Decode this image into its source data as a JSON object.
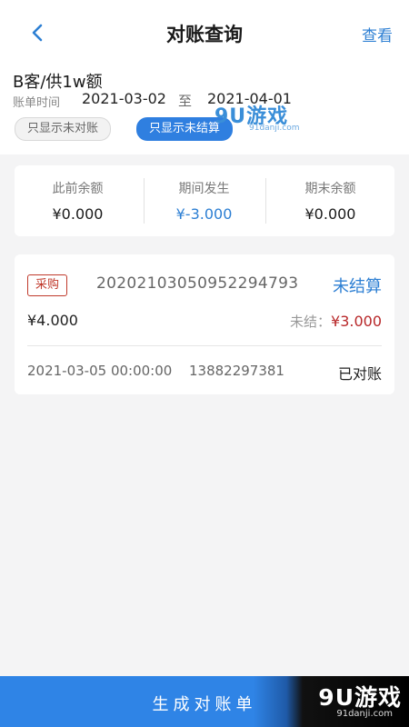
{
  "header": {
    "title": "对账查询",
    "view_label": "查看"
  },
  "info": {
    "customer": "B客/供1w额",
    "period_label": "账单时间",
    "start_date": "2021-03-02",
    "separator": "至",
    "end_date": "2021-04-01",
    "chips": [
      {
        "label": "只显示未对账",
        "active": false
      },
      {
        "label": "只显示未结算",
        "active": true
      }
    ]
  },
  "summary": [
    {
      "label": "此前余额",
      "value": "¥0.000"
    },
    {
      "label": "期间发生",
      "value": "¥-3.000"
    },
    {
      "label": "期末余额",
      "value": "¥0.000"
    }
  ],
  "records": [
    {
      "tag": "采购",
      "order_no": "20202103050952294793",
      "status": "未结算",
      "amount": "¥4.000",
      "unsettled_label": "未结：",
      "unsettled_value": "¥3.000",
      "time": "2021-03-05 00:00:00",
      "phone": "13882297381",
      "reconcile_status": "已对账"
    }
  ],
  "bottom": {
    "generate_label": "生成对账单"
  },
  "watermark": {
    "top_main": "9U游戏",
    "top_sub": "91danji.com",
    "bottom_main": "9U游戏",
    "bottom_sub": "91danji.com"
  },
  "colors": {
    "accent": "#2f7fe0",
    "negative": "#b8282a",
    "tag": "#c0392b"
  },
  "icons": {
    "back": "chevron-left-icon"
  }
}
